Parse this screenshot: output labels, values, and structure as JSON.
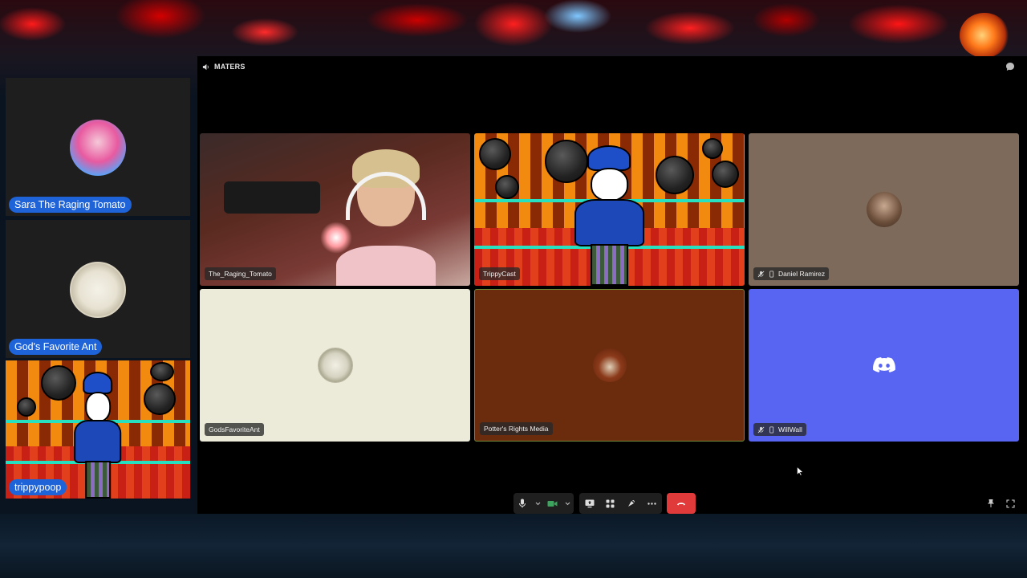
{
  "sidebar": {
    "cards": [
      {
        "name": "Sara The Raging Tomato"
      },
      {
        "name": "God's Favorite Ant"
      },
      {
        "name": "trippypoop"
      }
    ]
  },
  "channel": {
    "name": "MATERS",
    "speaker_icon": "speaker-icon",
    "chat_icon": "chat-bubble-icon"
  },
  "tiles": [
    {
      "label": "The_Raging_Tomato",
      "muted": false
    },
    {
      "label": "TrippyCast",
      "muted": false
    },
    {
      "label": "Daniel Ramirez",
      "muted": true,
      "mobile": true
    },
    {
      "label": "GodsFavoriteAnt",
      "muted": false
    },
    {
      "label": "Potter's Rights Media",
      "muted": false
    },
    {
      "label": "WillWall",
      "muted": true,
      "mobile": true
    }
  ],
  "controls": {
    "icons": [
      "microphone-icon",
      "chevron-down-icon",
      "camera-icon",
      "chevron-down-icon",
      "screen-share-icon",
      "activities-icon",
      "soundboard-icon",
      "more-icon",
      "hang-up-icon"
    ],
    "right_icons": [
      "pin-icon",
      "fullscreen-icon"
    ]
  },
  "colors": {
    "name_badge": "#1e63d8",
    "discord_blurple": "#5865f2",
    "leave_red": "#e03a3a",
    "camera_green": "#3ba55d"
  }
}
